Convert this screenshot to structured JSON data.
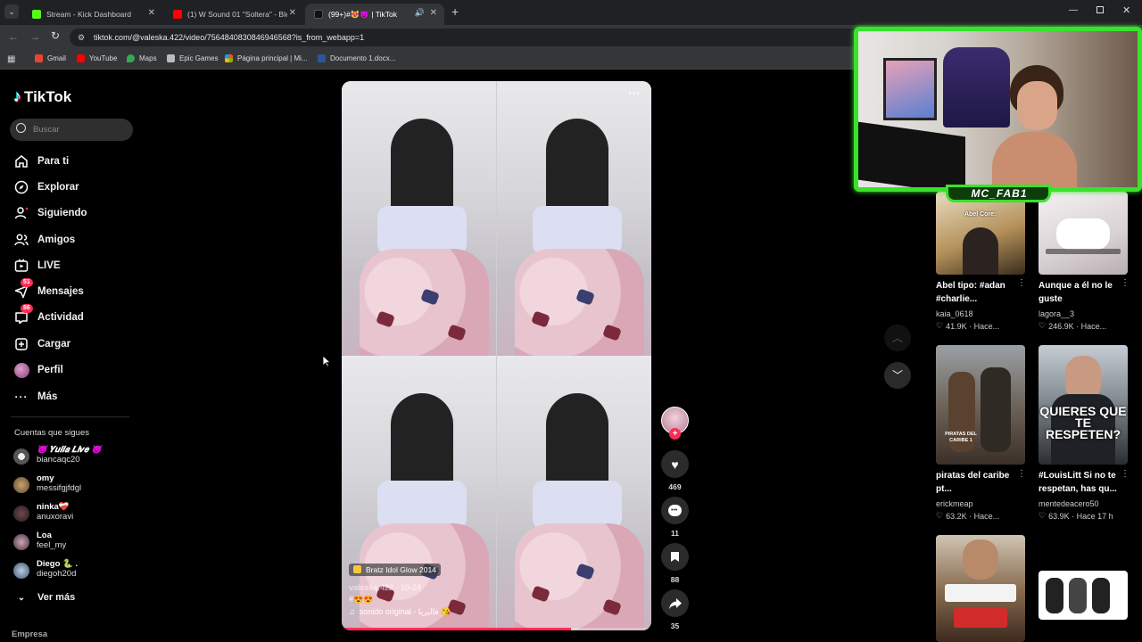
{
  "browser": {
    "tabs": [
      {
        "title": "Stream - Kick Dashboard",
        "favicon_color": "#53fc18"
      },
      {
        "title": "(1) W Sound 01 \"Soltera\" - Bles",
        "favicon_color": "#ff0000"
      },
      {
        "title": "(99+)#😻😈 | TikTok",
        "favicon_color": "#111111"
      }
    ],
    "url": "tiktok.com/@valeska.422/video/7564840830846946568?is_from_webapp=1",
    "bookmarks": [
      "Gmail",
      "YouTube",
      "Maps",
      "Epic Games",
      "Página principal | Mi...",
      "Documento 1.docx..."
    ]
  },
  "sidebar": {
    "logo": "TikTok",
    "search_placeholder": "Buscar",
    "nav": [
      {
        "label": "Para ti",
        "icon": "home-icon"
      },
      {
        "label": "Explorar",
        "icon": "compass-icon"
      },
      {
        "label": "Siguiendo",
        "icon": "following-icon"
      },
      {
        "label": "Amigos",
        "icon": "friends-icon"
      },
      {
        "label": "LIVE",
        "icon": "live-icon"
      },
      {
        "label": "Mensajes",
        "icon": "messages-icon",
        "badge": "51"
      },
      {
        "label": "Actividad",
        "icon": "activity-icon",
        "badge": "86"
      },
      {
        "label": "Cargar",
        "icon": "upload-icon"
      },
      {
        "label": "Perfil",
        "icon": "profile-icon"
      },
      {
        "label": "Más",
        "icon": "more-icon"
      }
    ],
    "following_title": "Cuentas que sigues",
    "following": [
      {
        "name": "😈 𝒀𝒖𝒍𝒊𝒂 𝑳𝒊𝒗𝒆 😈",
        "handle": "biancaqc20"
      },
      {
        "name": "omy",
        "handle": "messifgjfdgl"
      },
      {
        "name": "ninka❤️‍🩹",
        "handle": "anuxoravi"
      },
      {
        "name": "Loa",
        "handle": "feel_my"
      },
      {
        "name": "Diego 🐍 .",
        "handle": "diegoh20d"
      }
    ],
    "see_more": "Ver más",
    "footer": "Empresa"
  },
  "video": {
    "effect_label": "Bratz Idol Glow 2014",
    "author_line": "valeska.422 · 10-24",
    "desc": "#😍😍",
    "sound": "sonido original - فاليريا 😘",
    "progress": 0.74
  },
  "actions": {
    "likes": "469",
    "comments": "11",
    "saves": "88",
    "shares": "35"
  },
  "recommended": [
    {
      "title": "Abel tipo: #adan #charlie...",
      "user": "kaia_0618",
      "meta": "41.9K · Hace...",
      "thumb_text": "Abel Core:"
    },
    {
      "title": "Aunque a él no le guste",
      "user": "lagora__3",
      "meta": "246.9K · Hace..."
    },
    {
      "title": "piratas del caribe pt...",
      "user": "erickmeap",
      "meta": "63.2K · Hace...",
      "thumb_text": "PIRATAS DEL CARIBE 1"
    },
    {
      "title": "#LouisLitt Si no te respetan, has qu...",
      "user": "mentedeacero50",
      "meta": "63.9K · Hace 17 h",
      "thumb_text": "QUIERES QUE TE RESPETEN?"
    }
  ],
  "webcam": {
    "streamer_name": "MC_FAB1",
    "frame_color": "#39e22b"
  }
}
